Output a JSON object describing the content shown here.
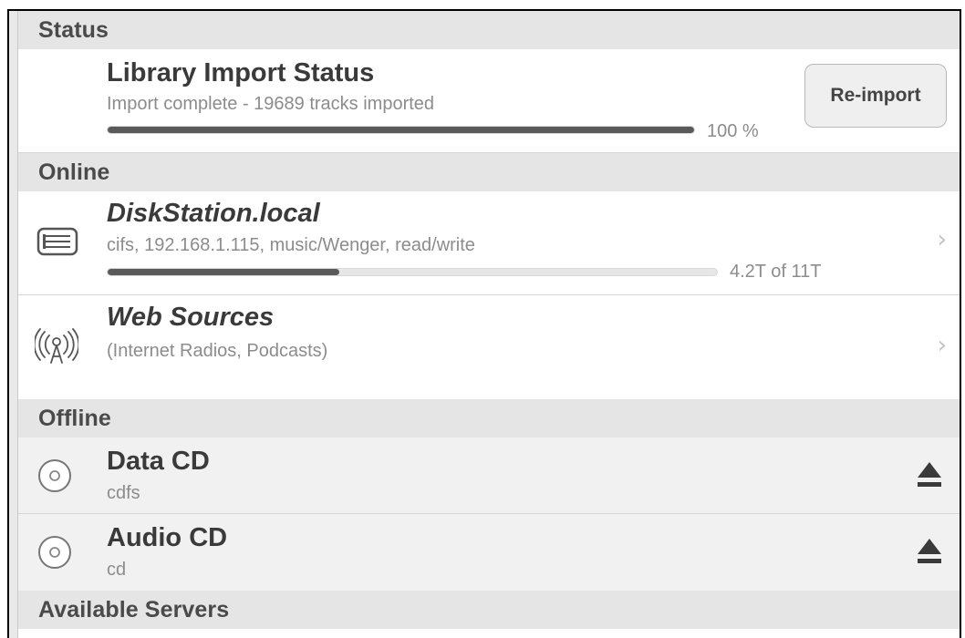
{
  "sections": {
    "status": "Status",
    "online": "Online",
    "offline": "Offline",
    "available": "Available Servers"
  },
  "library": {
    "title": "Library Import Status",
    "subtitle": "Import complete - 19689 tracks imported",
    "progress_fraction": 1.0,
    "progress_label": "100 %",
    "button_label": "Re-import"
  },
  "diskstation": {
    "title": "DiskStation.local",
    "subtitle": "cifs, 192.168.1.115, music/Wenger, read/write",
    "usage_fraction": 0.38,
    "usage_label": "4.2T of 11T",
    "icon": "server-icon",
    "chevron": "›"
  },
  "web_sources": {
    "title": "Web Sources",
    "subtitle": "(Internet Radios, Podcasts)",
    "icon": "antenna-icon",
    "chevron": "›"
  },
  "data_cd": {
    "title": "Data CD",
    "subtitle": "cdfs",
    "icon": "disc-icon"
  },
  "audio_cd": {
    "title": "Audio CD",
    "subtitle": "cd",
    "icon": "disc-icon"
  }
}
